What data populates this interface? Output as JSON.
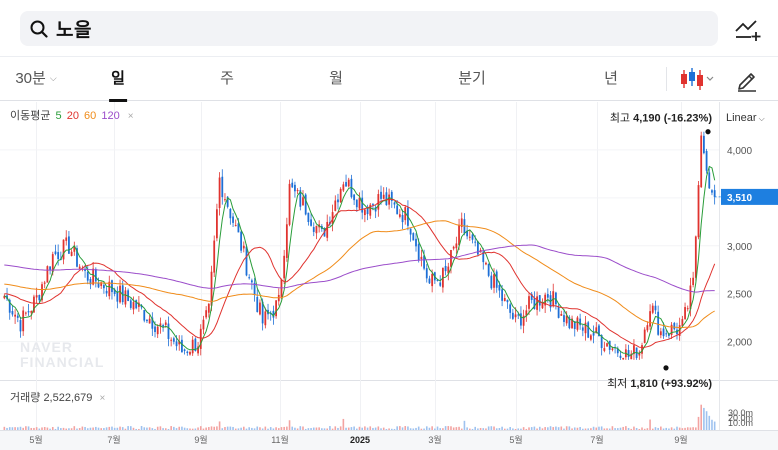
{
  "search": {
    "query": "노을",
    "icon": "search-icon"
  },
  "header": {
    "compare_icon": "chart-compare-icon"
  },
  "tabs": [
    {
      "label": "30분",
      "caret": "⌵"
    },
    {
      "label": "일",
      "active": true
    },
    {
      "label": "주"
    },
    {
      "label": "월"
    },
    {
      "label": "분기"
    },
    {
      "label": "년"
    }
  ],
  "toolbar": {
    "candle_icon": "candlestick-icon",
    "edit_icon": "pencil-icon"
  },
  "ma_legend": {
    "title": "이동평균",
    "periods": [
      {
        "label": "5",
        "color": "#2a9d3a"
      },
      {
        "label": "20",
        "color": "#e0332f"
      },
      {
        "label": "60",
        "color": "#f08c1a"
      },
      {
        "label": "120",
        "color": "#9b4dca"
      }
    ],
    "close": "×"
  },
  "scale": {
    "label": "Linear",
    "caret": "⌵"
  },
  "price_marks": {
    "high": {
      "prefix": "최고",
      "value": "4,190",
      "change": "(-16.23%)"
    },
    "low": {
      "prefix": "최저",
      "value": "1,810",
      "change": "(+93.92%)"
    },
    "current": "3,510"
  },
  "watermark": [
    "NAVER",
    "FINANCIAL"
  ],
  "volume": {
    "label": "거래량",
    "value": "2,522,679",
    "close": "×",
    "axis": [
      "30.0m",
      "20.0m",
      "10.0m"
    ]
  },
  "colors": {
    "up": "#e0332f",
    "down": "#1d6fd6",
    "current_badge": "#1e7fe0"
  },
  "chart_data": {
    "type": "candlestick",
    "y_axis": {
      "ticks": [
        "4,000",
        "3,500",
        "3,000",
        "2,500",
        "2,000"
      ],
      "range": [
        1600,
        4500
      ]
    },
    "x_axis": {
      "ticks": [
        "5월",
        "7월",
        "9월",
        "11월",
        "2025",
        "3월",
        "5월",
        "7월",
        "9월"
      ]
    },
    "close_anchors": [
      [
        0,
        2480
      ],
      [
        6,
        2200
      ],
      [
        12,
        2450
      ],
      [
        18,
        2900
      ],
      [
        24,
        3000
      ],
      [
        30,
        2700
      ],
      [
        40,
        2550
      ],
      [
        50,
        2350
      ],
      [
        60,
        2100
      ],
      [
        66,
        1900
      ],
      [
        72,
        2000
      ],
      [
        76,
        2300
      ],
      [
        80,
        3700
      ],
      [
        88,
        3000
      ],
      [
        96,
        2200
      ],
      [
        102,
        2400
      ],
      [
        106,
        3600
      ],
      [
        112,
        3400
      ],
      [
        118,
        3100
      ],
      [
        126,
        3700
      ],
      [
        134,
        3400
      ],
      [
        140,
        3500
      ],
      [
        150,
        3300
      ],
      [
        158,
        2600
      ],
      [
        164,
        2700
      ],
      [
        170,
        3200
      ],
      [
        176,
        2900
      ],
      [
        184,
        2500
      ],
      [
        190,
        2200
      ],
      [
        196,
        2400
      ],
      [
        202,
        2500
      ],
      [
        210,
        2200
      ],
      [
        218,
        2100
      ],
      [
        226,
        1950
      ],
      [
        232,
        1850
      ],
      [
        236,
        1900
      ],
      [
        240,
        2400
      ],
      [
        244,
        2100
      ],
      [
        252,
        2150
      ],
      [
        256,
        2600
      ],
      [
        259,
        4150
      ],
      [
        262,
        3600
      ],
      [
        264,
        3510
      ]
    ],
    "high": 4190,
    "low": 1810,
    "last": 3510
  }
}
